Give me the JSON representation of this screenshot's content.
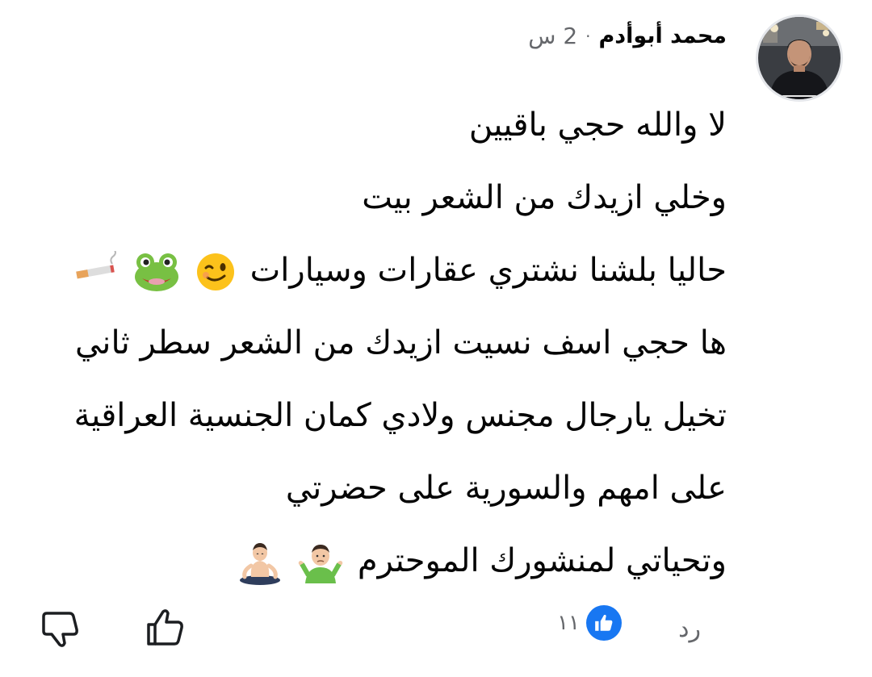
{
  "comment": {
    "author": "محمد أبوأدم",
    "separator": "·",
    "time": "2 س",
    "lines": [
      "لا والله حجي باقيين",
      "وخلي ازيدك من الشعر بيت",
      "حاليا بلشنا نشتري عقارات وسيارات",
      "ها حجي اسف نسيت ازيدك من الشعر سطر ثاني",
      "تخيل يارجال مجنس ولادي كمان الجنسية العراقية",
      "على امهم والسورية على حضرتي",
      "وتحياتي لمنشورك الموحترم"
    ],
    "line3_emojis": [
      "wink-emoji",
      "frog-emoji",
      "cigarette-emoji"
    ],
    "line7_emojis": [
      "shrug-man-emoji",
      "meditating-man-emoji"
    ]
  },
  "actions": {
    "reply_label": "رد",
    "reaction_count": "١١",
    "reaction_icon": "like-badge-icon",
    "like_icon": "thumbs-up-icon",
    "dislike_icon": "thumbs-down-icon"
  },
  "colors": {
    "text": "#050505",
    "secondary": "#65676b",
    "accent": "#1877f2"
  }
}
